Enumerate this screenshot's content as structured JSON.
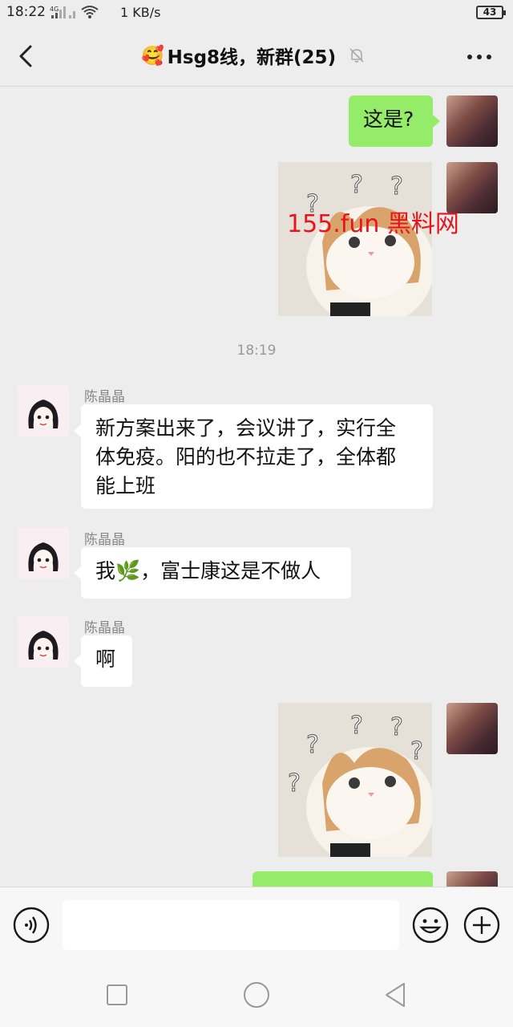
{
  "status_bar": {
    "time": "18:22",
    "network": "4G",
    "speed": "1 KB/s",
    "battery": "43"
  },
  "header": {
    "title": "Hsg8线，新群(25)",
    "title_emoji": "🥰",
    "back_icon": "chevron-left-icon",
    "mute_icon": "bell-off-icon",
    "more_icon": "more-icon"
  },
  "messages": {
    "m1_text": "这是?",
    "timestamp": "18:19",
    "m3_sender": "陈晶晶",
    "m3_text_line1": "新方案出来了，会议讲了，实行全",
    "m3_text_line2": "体免疫。阳的也不拉走了，全体都",
    "m3_text_line3": "能上班",
    "m4_sender": "陈晶晶",
    "m4_text_pre": "我",
    "m4_text_emoji": "🌿",
    "m4_text_post": "，富士康这是不做人",
    "m5_sender": "陈晶晶",
    "m5_text": "啊"
  },
  "watermark": "155.fun 黑料网",
  "input_bar": {
    "placeholder": "",
    "voice_icon": "voice-icon",
    "emoji_icon": "emoji-icon",
    "plus_icon": "plus-icon"
  },
  "colors": {
    "bubble_self": "#95ec69",
    "bubble_other": "#ffffff",
    "background": "#ededed",
    "watermark": "#e8141c"
  }
}
